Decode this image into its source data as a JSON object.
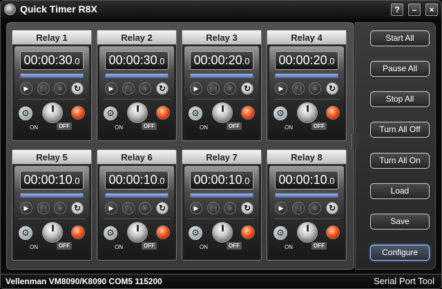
{
  "window": {
    "title": "Quick Timer R8X",
    "help_label": "?",
    "minimize_label": "–",
    "close_label": "×"
  },
  "relays": [
    {
      "name": "Relay 1",
      "time_main": "00:00:30",
      "time_tenths": ".0",
      "progress": 1.0
    },
    {
      "name": "Relay 2",
      "time_main": "00:00:30",
      "time_tenths": ".0",
      "progress": 1.0
    },
    {
      "name": "Relay 3",
      "time_main": "00:00:20",
      "time_tenths": ".0",
      "progress": 1.0
    },
    {
      "name": "Relay 4",
      "time_main": "00:00:20",
      "time_tenths": ".0",
      "progress": 1.0
    },
    {
      "name": "Relay 5",
      "time_main": "00:00:10",
      "time_tenths": ".0",
      "progress": 1.0
    },
    {
      "name": "Relay 6",
      "time_main": "00:00:10",
      "time_tenths": ".0",
      "progress": 1.0
    },
    {
      "name": "Relay 7",
      "time_main": "00:00:10",
      "time_tenths": ".0",
      "progress": 1.0
    },
    {
      "name": "Relay 8",
      "time_main": "00:00:10",
      "time_tenths": ".0",
      "progress": 1.0
    }
  ],
  "relay_labels": {
    "on": "ON",
    "off": "OFF"
  },
  "relay_icons": [
    "play-icon",
    "pause-icon",
    "stop-icon",
    "reset-icon",
    "gear-icon",
    "knob",
    "led-indicator"
  ],
  "side_buttons": [
    {
      "label": "Start All"
    },
    {
      "label": "Pause All"
    },
    {
      "label": "Stop All"
    },
    {
      "label": "Turn All Off"
    },
    {
      "label": "Turn All On"
    },
    {
      "label": "Load"
    },
    {
      "label": "Save"
    },
    {
      "label": "Configure"
    }
  ],
  "status": {
    "device": "Vellenman VM8090/K8090 COM5 115200",
    "tool": "Serial Port Tool"
  },
  "colors": {
    "progress": "#4d72c8",
    "led": "#ff5a1e",
    "accent": "#9ec3ff"
  }
}
